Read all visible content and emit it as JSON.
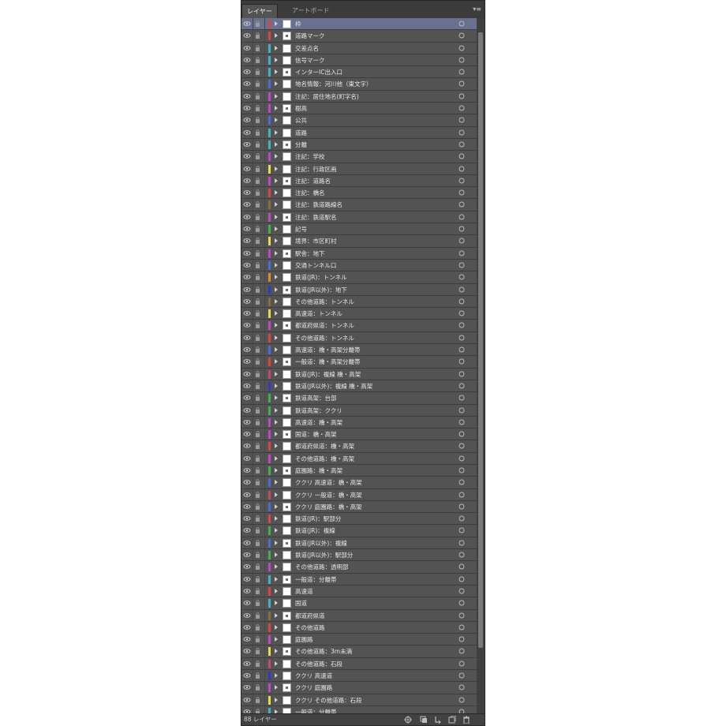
{
  "panel": {
    "tabs": [
      {
        "label": "レイヤー"
      },
      {
        "label": "アートボード"
      }
    ],
    "menu_icon": "panel-menu-icon",
    "layer_count": "88 レイヤー",
    "footer_icons": [
      "locate-object-icon",
      "make-clipping-mask-icon",
      "new-sublayer-icon",
      "new-layer-icon",
      "delete-layer-icon"
    ]
  },
  "colors": {
    "panel_bg": "#535353",
    "selected_row": "#6a7190",
    "tab_bar": "#3b3b3b"
  },
  "layers": [
    {
      "name": "枠",
      "color": "#d8463f",
      "selected": true
    },
    {
      "name": "道路マーク",
      "color": "#d8463f"
    },
    {
      "name": "交差点名",
      "color": "#3fb2c6"
    },
    {
      "name": "信号マーク",
      "color": "#3fb2c6"
    },
    {
      "name": "インターIC出入口",
      "color": "#3fb2c6"
    },
    {
      "name": "地名情報：河川他（東文字）",
      "color": "#4a6be0"
    },
    {
      "name": "注記：居住地名(町字名)",
      "color": "#c247c8"
    },
    {
      "name": "樹高",
      "color": "#c247c8"
    },
    {
      "name": "公共",
      "color": "#4a6be0"
    },
    {
      "name": "道路",
      "color": "#3fb2c6"
    },
    {
      "name": "分離",
      "color": "#3fb2c6"
    },
    {
      "name": "注記：学校",
      "color": "#c247c8"
    },
    {
      "name": "注記：行政区画",
      "color": "#e6d94a"
    },
    {
      "name": "注記：道路名",
      "color": "#c247c8"
    },
    {
      "name": "注記：橋名",
      "color": "#d8463f"
    },
    {
      "name": "注記：鉄道路線名",
      "color": "#8a6d3b"
    },
    {
      "name": "注記：鉄道駅名",
      "color": "#c247c8"
    },
    {
      "name": "記号",
      "color": "#3fb24a"
    },
    {
      "name": "境界：市区町村",
      "color": "#e6d94a"
    },
    {
      "name": "駅舎：地下",
      "color": "#c247c8"
    },
    {
      "name": "交通トンネル口",
      "color": "#4a6be0"
    },
    {
      "name": "鉄道(JR)：トンネル",
      "color": "#e08a2e"
    },
    {
      "name": "鉄道(JR以外)：地下",
      "color": "#2e3bc4"
    },
    {
      "name": "その他道路：トンネル",
      "color": "#8a6d3b"
    },
    {
      "name": "高速道：トンネル",
      "color": "#e6d94a"
    },
    {
      "name": "都道府県道：トンネル",
      "color": "#c247c8"
    },
    {
      "name": "その他道路：トンネル",
      "color": "#d8463f"
    },
    {
      "name": "高速道：橋・高架分離帯",
      "color": "#4a6be0"
    },
    {
      "name": "一般道：橋・高架分離帯",
      "color": "#d8463f"
    },
    {
      "name": "鉄道(JR)：複線 橋・高架",
      "color": "#c24a6a"
    },
    {
      "name": "鉄道(JR以外)：複線 橋・高架",
      "color": "#2e3bc4"
    },
    {
      "name": "鉄道高架：台部",
      "color": "#3fb24a"
    },
    {
      "name": "鉄道高架：ククリ",
      "color": "#3fb24a"
    },
    {
      "name": "高速道：橋・高架",
      "color": "#c247c8"
    },
    {
      "name": "国道：橋・高架",
      "color": "#c247c8"
    },
    {
      "name": "都道府県道：橋・高架",
      "color": "#d8463f"
    },
    {
      "name": "その他道路：橋・高架",
      "color": "#c247c8"
    },
    {
      "name": "庭園路：橋・高架",
      "color": "#3fb24a"
    },
    {
      "name": "ククリ 高速道：橋・高架",
      "color": "#4a6be0"
    },
    {
      "name": "ククリ 一般道：橋・高架",
      "color": "#c24a6a"
    },
    {
      "name": "ククリ 庭園路：橋・高架",
      "color": "#4a6be0"
    },
    {
      "name": "鉄道(JR)：駅部分",
      "color": "#d8463f"
    },
    {
      "name": "鉄道(JR)：複線",
      "color": "#3fb24a"
    },
    {
      "name": "鉄道(JR以外)：複線",
      "color": "#4a6be0"
    },
    {
      "name": "鉄道(JR以外)：駅部分",
      "color": "#3fb24a"
    },
    {
      "name": "その他道路：透明部",
      "color": "#c247c8"
    },
    {
      "name": "一般道：分離帯",
      "color": "#3fb2c6"
    },
    {
      "name": "高速道",
      "color": "#d8463f"
    },
    {
      "name": "国道",
      "color": "#3fb2c6"
    },
    {
      "name": "都道府県道",
      "color": "#8a6d3b"
    },
    {
      "name": "その他道路",
      "color": "#d8463f"
    },
    {
      "name": "庭園路",
      "color": "#c247c8"
    },
    {
      "name": "その他道路：3m未満",
      "color": "#e6d94a"
    },
    {
      "name": "その他道路：石段",
      "color": "#c24a6a"
    },
    {
      "name": "ククリ 高速道",
      "color": "#2e3bc4"
    },
    {
      "name": "ククリ 庭園路",
      "color": "#c247c8"
    },
    {
      "name": "ククリ その他道路：石段",
      "color": "#e6d94a"
    },
    {
      "name": "一般道：分離帯",
      "color": "#3fb2c6"
    }
  ]
}
